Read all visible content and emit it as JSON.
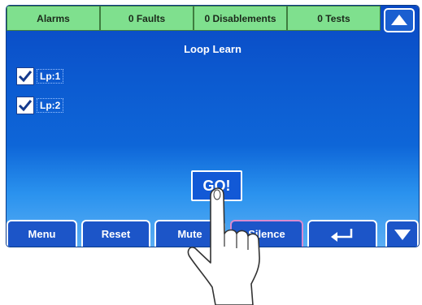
{
  "status_bar": [
    "Alarms",
    "0 Faults",
    "0 Disablements",
    "0 Tests"
  ],
  "title": "Loop Learn",
  "loops": [
    {
      "label": "Lp:1",
      "checked": true
    },
    {
      "label": "Lp:2",
      "checked": true
    }
  ],
  "go_label": "GO!",
  "bottom_bar": {
    "menu": "Menu",
    "reset": "Reset",
    "mute": "Mute",
    "silence": "Silence"
  },
  "icons": {
    "scroll_up": "up-arrow-icon",
    "scroll_down": "down-arrow-icon",
    "back": "return-arrow-icon",
    "pointer": "pointing-hand-icon"
  },
  "colors": {
    "status_green": "#7fe08e",
    "screen_blue": "#0c5ad0",
    "button_blue": "#1c55c8",
    "silence_border": "#d98bd0"
  }
}
